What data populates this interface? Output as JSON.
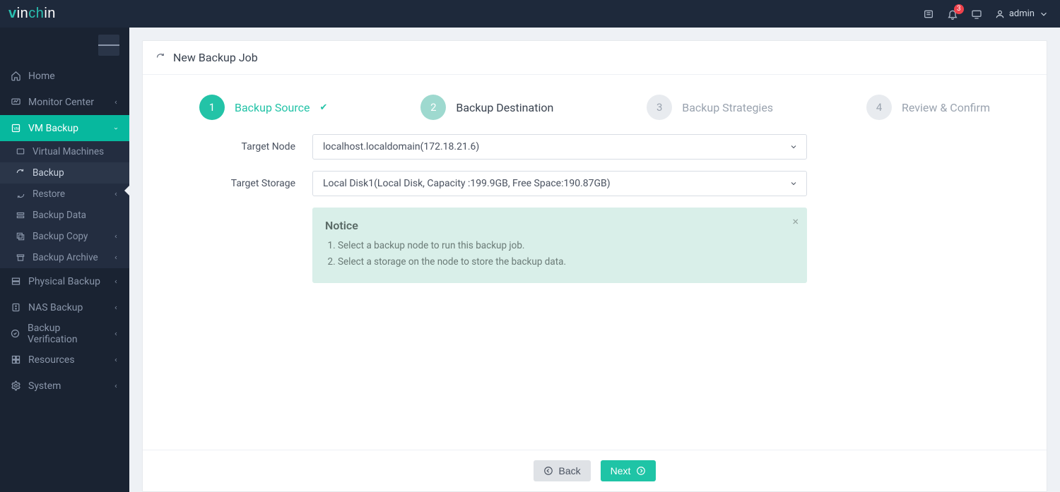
{
  "brand": {
    "name": "vinchin"
  },
  "topbar": {
    "notifications_count": "3",
    "user_label": "admin"
  },
  "sidebar": {
    "home": "Home",
    "monitor_center": "Monitor Center",
    "vm_backup": "VM Backup",
    "sub": {
      "virtual_machines": "Virtual Machines",
      "backup": "Backup",
      "restore": "Restore",
      "backup_data": "Backup Data",
      "backup_copy": "Backup Copy",
      "backup_archive": "Backup Archive"
    },
    "physical_backup": "Physical Backup",
    "nas_backup": "NAS Backup",
    "backup_verification": "Backup Verification",
    "resources": "Resources",
    "system": "System"
  },
  "page": {
    "title": "New Backup Job",
    "steps": {
      "s1": {
        "num": "1",
        "label": "Backup Source"
      },
      "s2": {
        "num": "2",
        "label": "Backup Destination"
      },
      "s3": {
        "num": "3",
        "label": "Backup Strategies"
      },
      "s4": {
        "num": "4",
        "label": "Review & Confirm"
      }
    },
    "form": {
      "target_node_label": "Target Node",
      "target_node_value": "localhost.localdomain(172.18.21.6)",
      "target_storage_label": "Target Storage",
      "target_storage_value": "Local Disk1(Local Disk, Capacity :199.9GB, Free Space:190.87GB)"
    },
    "notice": {
      "heading": "Notice",
      "line1": "Select a backup node to run this backup job.",
      "line2": "Select a storage on the node to store the backup data."
    },
    "buttons": {
      "back": "Back",
      "next": "Next"
    }
  }
}
